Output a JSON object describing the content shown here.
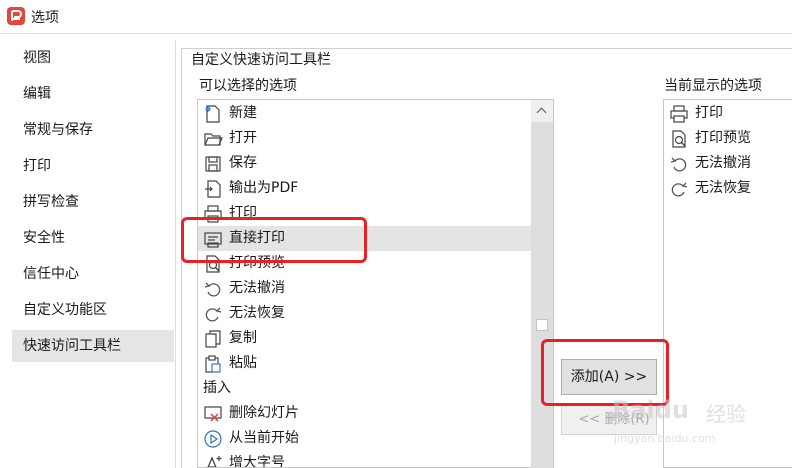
{
  "window": {
    "title": "选项",
    "logo_letter": "P"
  },
  "sidebar": {
    "items": [
      {
        "label": "视图"
      },
      {
        "label": "编辑"
      },
      {
        "label": "常规与保存"
      },
      {
        "label": "打印"
      },
      {
        "label": "拼写检查"
      },
      {
        "label": "安全性"
      },
      {
        "label": "信任中心"
      },
      {
        "label": "自定义功能区"
      },
      {
        "label": "快速访问工具栏",
        "active": true
      }
    ]
  },
  "main": {
    "group_title": "自定义快速访问工具栏",
    "available_label": "可以选择的选项",
    "current_label": "当前显示的选项",
    "available_items": [
      {
        "label": "新建",
        "icon": "new-file-icon"
      },
      {
        "label": "打开",
        "icon": "folder-open-icon"
      },
      {
        "label": "保存",
        "icon": "save-icon"
      },
      {
        "label": "输出为PDF",
        "icon": "export-pdf-icon"
      },
      {
        "label": "打印",
        "icon": "printer-icon"
      },
      {
        "label": "直接打印",
        "icon": "direct-print-icon",
        "selected": true
      },
      {
        "label": "打印预览",
        "icon": "print-preview-icon"
      },
      {
        "label": "无法撤消",
        "icon": "undo-icon"
      },
      {
        "label": "无法恢复",
        "icon": "redo-icon"
      },
      {
        "label": "复制",
        "icon": "copy-icon"
      },
      {
        "label": "粘贴",
        "icon": "paste-icon"
      },
      {
        "label": "插入",
        "section": true
      },
      {
        "label": "删除幻灯片",
        "icon": "delete-slide-icon"
      },
      {
        "label": "从当前开始",
        "icon": "play-from-current-icon"
      },
      {
        "label": "增大字号",
        "icon": "increase-font-icon"
      }
    ],
    "current_items": [
      {
        "label": "打印",
        "icon": "printer-icon"
      },
      {
        "label": "打印预览",
        "icon": "print-preview-icon"
      },
      {
        "label": "无法撤消",
        "icon": "undo-icon"
      },
      {
        "label": "无法恢复",
        "icon": "redo-icon"
      }
    ],
    "add_button": "添加(A) >>",
    "remove_button": "<< 删除(R)"
  },
  "watermark": {
    "brand": "Baidu",
    "suffix": "经验",
    "url": "jingyan.baidu.com"
  },
  "colors": {
    "annotation_red": "#e8202a",
    "selected_bg": "#e4e4e4",
    "logo_red": "#e8443a"
  }
}
